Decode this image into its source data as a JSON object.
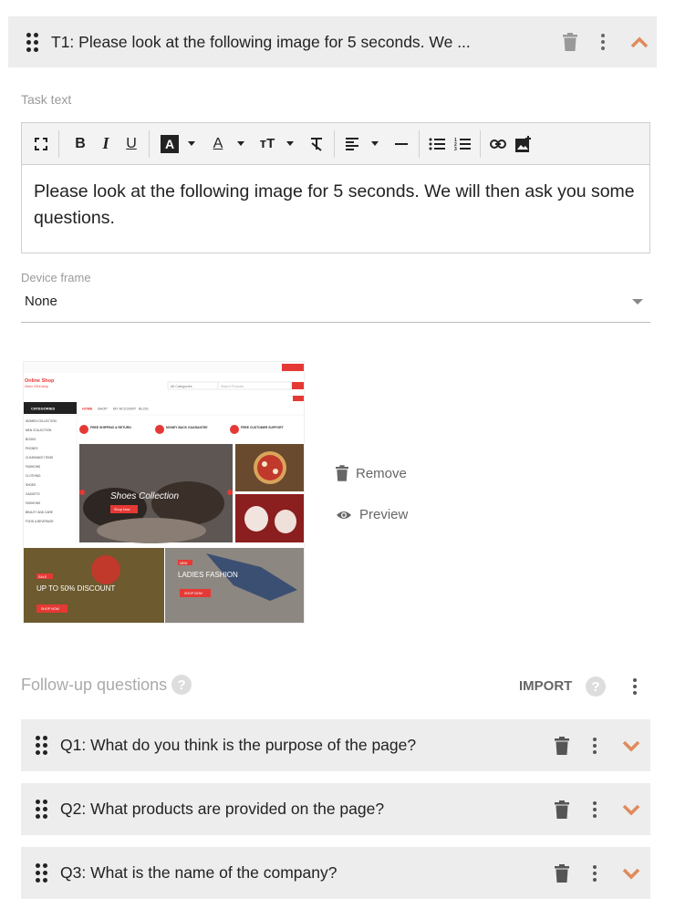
{
  "task": {
    "header_title": "T1: Please look at the following image for 5 seconds. We ...",
    "task_text_label": "Task text",
    "body_text": "Please look at the following image for 5 seconds. We will then ask you some questions.",
    "device_frame_label": "Device frame",
    "device_frame_value": "None",
    "remove_label": "Remove",
    "preview_label": "Preview"
  },
  "thumbnail": {
    "shop_name": "Online Shop",
    "shop_tagline": "Demo 2016 shop",
    "categories_label": "CATEGORIES",
    "all_categories": "All Categories",
    "search_placeholder": "Search Products",
    "nav_items": [
      "HOME",
      "SHOP",
      "MY ACCOUNT",
      "BLOG"
    ],
    "feature_1": "FREE SHIPPING & RETURN",
    "feature_2": "MONEY BACK GUARANTEE",
    "feature_3": "FREE CUSTOMER SUPPORT",
    "category_list": [
      "WOMEN COLLECTION",
      "MEN COLLECTION",
      "BOOKS",
      "PHONES",
      "CLEARANCE ITEMS",
      "FASHIONS",
      "CLOTHING",
      "SHOES",
      "GADGETS",
      "FASHIONS",
      "BEAUTY AND CARE",
      "FOOD & BEVERAGE"
    ],
    "banner_title": "Shoes Collection",
    "banner_btn": "Shop Now",
    "promo_1": "UP TO 50% DISCOUNT",
    "promo_1_tag": "SALE",
    "promo_1_btn": "SHOP NOW",
    "promo_2": "LADIES FASHION",
    "promo_2_tag": "NEW",
    "promo_2_btn": "SHOP NOW"
  },
  "followup": {
    "label": "Follow-up questions",
    "help": "?",
    "import_label": "IMPORT",
    "questions": [
      {
        "title": "Q1: What do you think is the purpose of the page?"
      },
      {
        "title": "Q2: What products are provided on the page?"
      },
      {
        "title": "Q3: What is the name of the company?"
      }
    ]
  },
  "colors": {
    "accent": "#e08a5c",
    "header_bg": "#ededed",
    "thumb_red": "#e53935"
  }
}
